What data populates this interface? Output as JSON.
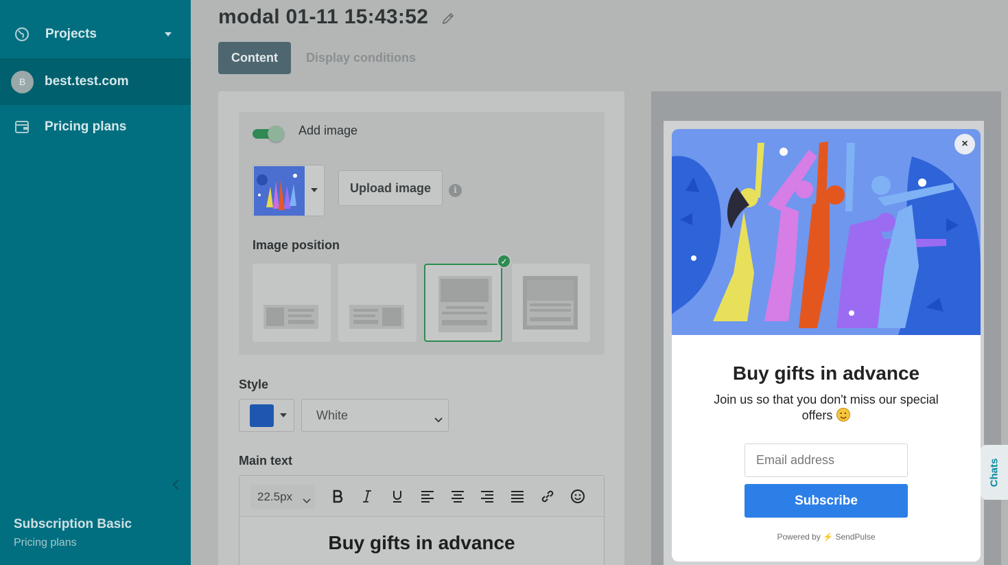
{
  "sidebar": {
    "projects_label": "Projects",
    "site_avatar": "B",
    "site_label": "best.test.com",
    "pricing_label": "Pricing plans",
    "plan_title": "Subscription Basic",
    "plan_sub": "Pricing plans"
  },
  "header": {
    "title": "modal 01-11 15:43:52",
    "tabs": [
      {
        "label": "Content",
        "active": true
      },
      {
        "label": "Display conditions",
        "active": false
      }
    ]
  },
  "editor": {
    "add_image_label": "Add image",
    "add_image_enabled": true,
    "upload_button": "Upload image",
    "image_position_label": "Image position",
    "image_position_selected": 3,
    "style_label": "Style",
    "style_color": "#1f57b0",
    "style_value": "White",
    "main_text_label": "Main text",
    "font_size": "22.5px",
    "main_text_content": "Buy gifts in advance"
  },
  "preview": {
    "close_glyph": "×",
    "title": "Buy gifts in advance",
    "subtitle": "Join us so that you don't miss our special offers",
    "email_placeholder": "Email address",
    "subscribe_label": "Subscribe",
    "powered_prefix": "Powered by",
    "powered_brand": "SendPulse",
    "accent_color": "#2d7fe8"
  },
  "chats_label": "Chats"
}
